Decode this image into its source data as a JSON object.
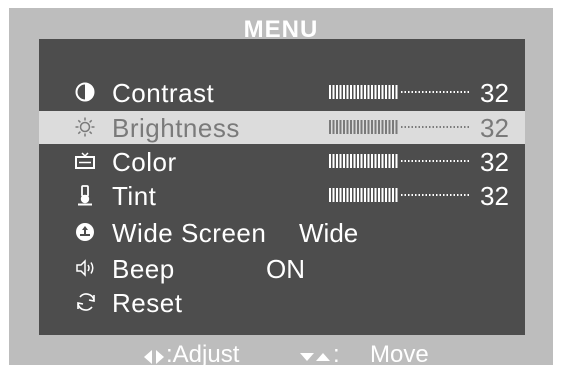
{
  "menu": {
    "title": "MENU"
  },
  "items": [
    {
      "label": "Contrast",
      "icon": "contrast-icon",
      "value": "32",
      "bar_fill": 0.5
    },
    {
      "label": "Brightness",
      "icon": "brightness-icon",
      "value": "32",
      "bar_fill": 0.5,
      "selected": true
    },
    {
      "label": "Color",
      "icon": "color-icon",
      "value": "32",
      "bar_fill": 0.5
    },
    {
      "label": "Tint",
      "icon": "tint-icon",
      "value": "32",
      "bar_fill": 0.5
    },
    {
      "label": "Wide Screen",
      "icon": "wide-screen-icon",
      "value": "Wide"
    },
    {
      "label": "Beep",
      "icon": "beep-icon",
      "value": "ON"
    },
    {
      "label": "Reset",
      "icon": "reset-icon"
    }
  ],
  "footer": {
    "adjust_label": ":Adjust",
    "move_label": ":",
    "move_text": "Move",
    "adjust_icon": "left-right-arrows-icon",
    "move_icon": "up-down-arrows-icon"
  },
  "colors": {
    "frame": "#bdbdbd",
    "panel": "#4d4d4d",
    "selected_row": "#dcdcdc",
    "text": "#ffffff",
    "selected_text": "#7a7a7a"
  }
}
